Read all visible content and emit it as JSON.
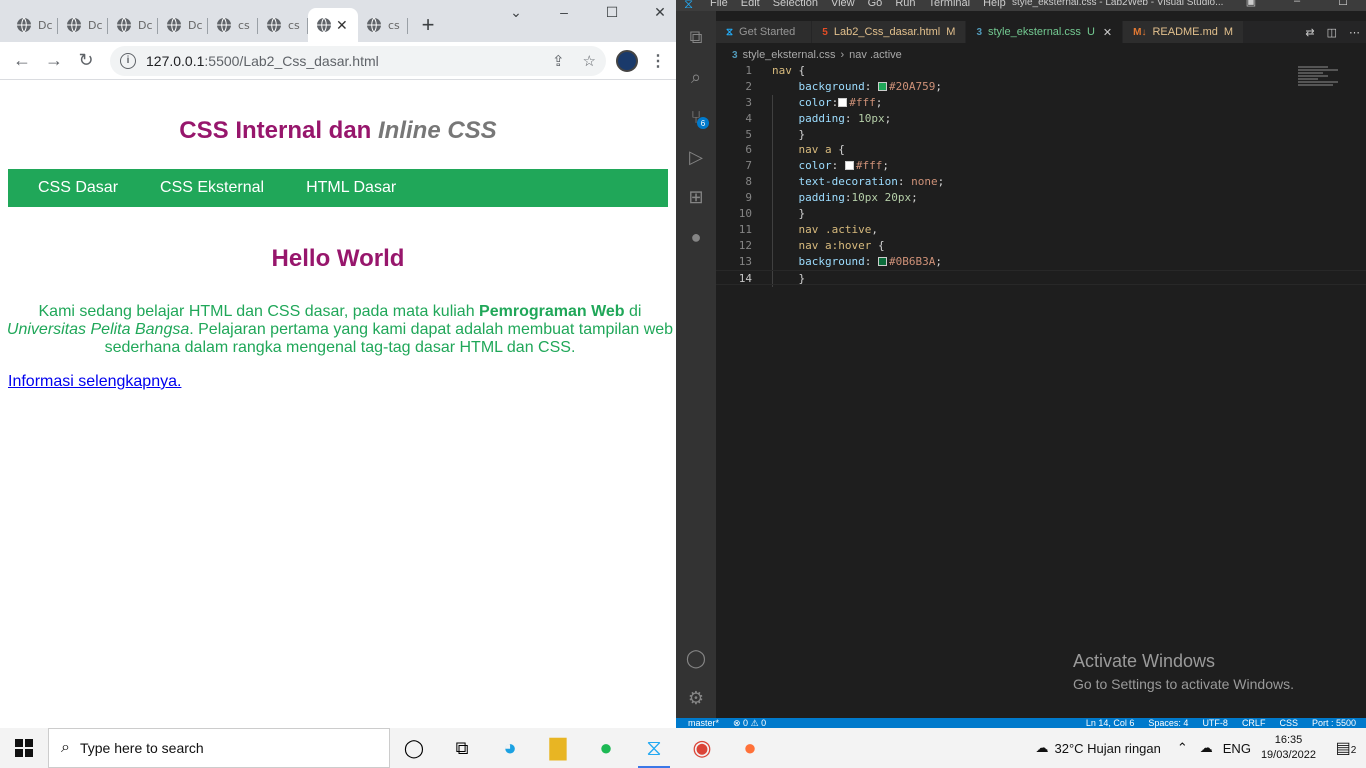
{
  "browser": {
    "tabs": [
      {
        "label": "Dc",
        "active": false
      },
      {
        "label": "Dc",
        "active": false
      },
      {
        "label": "Dc",
        "active": false
      },
      {
        "label": "Dc",
        "active": false
      },
      {
        "label": "cs",
        "active": false
      },
      {
        "label": "cs",
        "active": false
      },
      {
        "label": "",
        "active": true
      },
      {
        "label": "cs",
        "active": false
      }
    ],
    "url_host": "127.0.0.1",
    "url_path": ":5500/Lab2_Css_dasar.html"
  },
  "page": {
    "title_part1": "CSS Internal dan ",
    "title_em": "Inline CSS",
    "nav": [
      "CSS Dasar",
      "CSS Eksternal",
      "HTML Dasar"
    ],
    "heading": "Hello World",
    "para_1": "Kami sedang belajar HTML dan CSS dasar, pada mata kuliah ",
    "para_bold": "Pemrograman Web",
    "para_2": " di ",
    "para_em": "Universitas Pelita Bangsa",
    "para_3": ". Pelajaran pertama yang kami dapat adalah membuat tampilan web sederhana dalam rangka mengenal tag-tag dasar HTML dan CSS.",
    "link": "Informasi selengkapnya."
  },
  "vscode": {
    "menu": [
      "File",
      "Edit",
      "Selection",
      "View",
      "Go",
      "Run",
      "Terminal",
      "Help"
    ],
    "window_title": "style_eksternal.css - Lab2Web - Visual Studio...",
    "tabs": [
      {
        "label": "Get Started",
        "icon": "vscode-icon",
        "mark": ""
      },
      {
        "label": "Lab2_Css_dasar.html",
        "icon": "html5-icon",
        "mark": "M"
      },
      {
        "label": "style_eksternal.css",
        "icon": "css3-icon",
        "mark": "U"
      },
      {
        "label": "README.md",
        "icon": "markdown-icon",
        "mark": "M"
      }
    ],
    "breadcrumb_file": "style_eksternal.css",
    "breadcrumb_symbol": "nav .active",
    "scm_badge": "6",
    "code_lines": [
      {
        "n": "1",
        "html": "<span class='sel'>nav</span> <span class='punc'>{</span>"
      },
      {
        "n": "2",
        "html": "    <span class='prop'>background</span>: <span class='swatch' style='background:#20A759'></span><span class='kw'>#20A759</span>;"
      },
      {
        "n": "3",
        "html": "    <span class='prop'>color</span>:<span class='swatch' style='background:#fff'></span><span class='kw'>#fff</span>;"
      },
      {
        "n": "4",
        "html": "    <span class='prop'>padding</span>: <span class='num'>10px</span>;"
      },
      {
        "n": "5",
        "html": "    }"
      },
      {
        "n": "6",
        "html": "    <span class='sel'>nav a</span> {"
      },
      {
        "n": "7",
        "html": "    <span class='prop'>color</span>: <span class='swatch' style='background:#fff'></span><span class='kw'>#fff</span>;"
      },
      {
        "n": "8",
        "html": "    <span class='prop'>text-decoration</span>: <span class='kw'>none</span>;"
      },
      {
        "n": "9",
        "html": "    <span class='prop'>padding</span>:<span class='num'>10px 20px</span>;"
      },
      {
        "n": "10",
        "html": "    }"
      },
      {
        "n": "11",
        "html": "    <span class='sel'>nav .active</span>,"
      },
      {
        "n": "12",
        "html": "    <span class='sel'>nav a:hover</span> {"
      },
      {
        "n": "13",
        "html": "    <span class='prop'>background</span>: <span class='swatch' style='background:#0B6B3A'></span><span class='kw'>#0B6B3A</span>;"
      },
      {
        "n": "14",
        "html": "    }"
      }
    ],
    "watermark_title": "Activate Windows",
    "watermark_sub": "Go to Settings to activate Windows.",
    "status_left": [
      "master*",
      "⊗ 0 ⚠ 0"
    ],
    "status_right": [
      "Ln 14, Col 6",
      "Spaces: 4",
      "UTF-8",
      "CRLF",
      "CSS",
      "Port : 5500"
    ]
  },
  "taskbar": {
    "search_placeholder": "Type here to search",
    "weather": "32°C  Hujan ringan",
    "lang": "ENG",
    "time": "16:35",
    "date": "19/03/2022",
    "notif_count": "2"
  }
}
